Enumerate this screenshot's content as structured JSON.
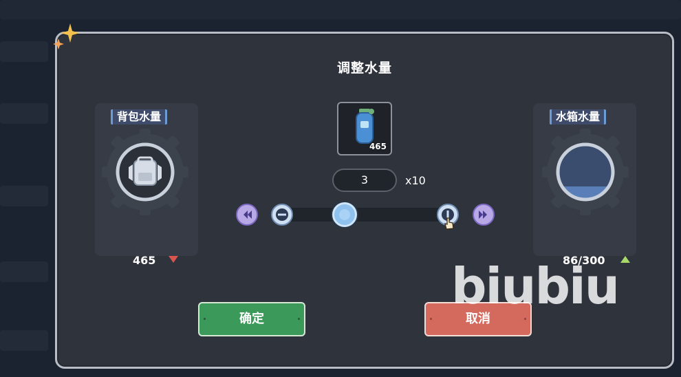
{
  "dialog": {
    "title": "调整水量",
    "backpack": {
      "label": "背包水量",
      "value": "465",
      "trend": "down",
      "trend_color": "#d9534f",
      "icon": "backpack-icon"
    },
    "tank": {
      "label": "水箱水量",
      "value": "86/300",
      "trend": "up",
      "trend_color": "#a8d96a",
      "icon": "water-tank-icon"
    },
    "item": {
      "icon": "water-bottle-icon",
      "count": "465"
    },
    "quantity": {
      "value": "3",
      "multiplier": "x10"
    },
    "slider": {
      "level": 0.33
    },
    "buttons": {
      "confirm": "确定",
      "cancel": "取消"
    }
  },
  "watermark": "biubiu",
  "colors": {
    "confirm": "#3b9a5a",
    "cancel": "#d4695e",
    "accent": "#b8a8e6",
    "panel": "#2f333c"
  }
}
